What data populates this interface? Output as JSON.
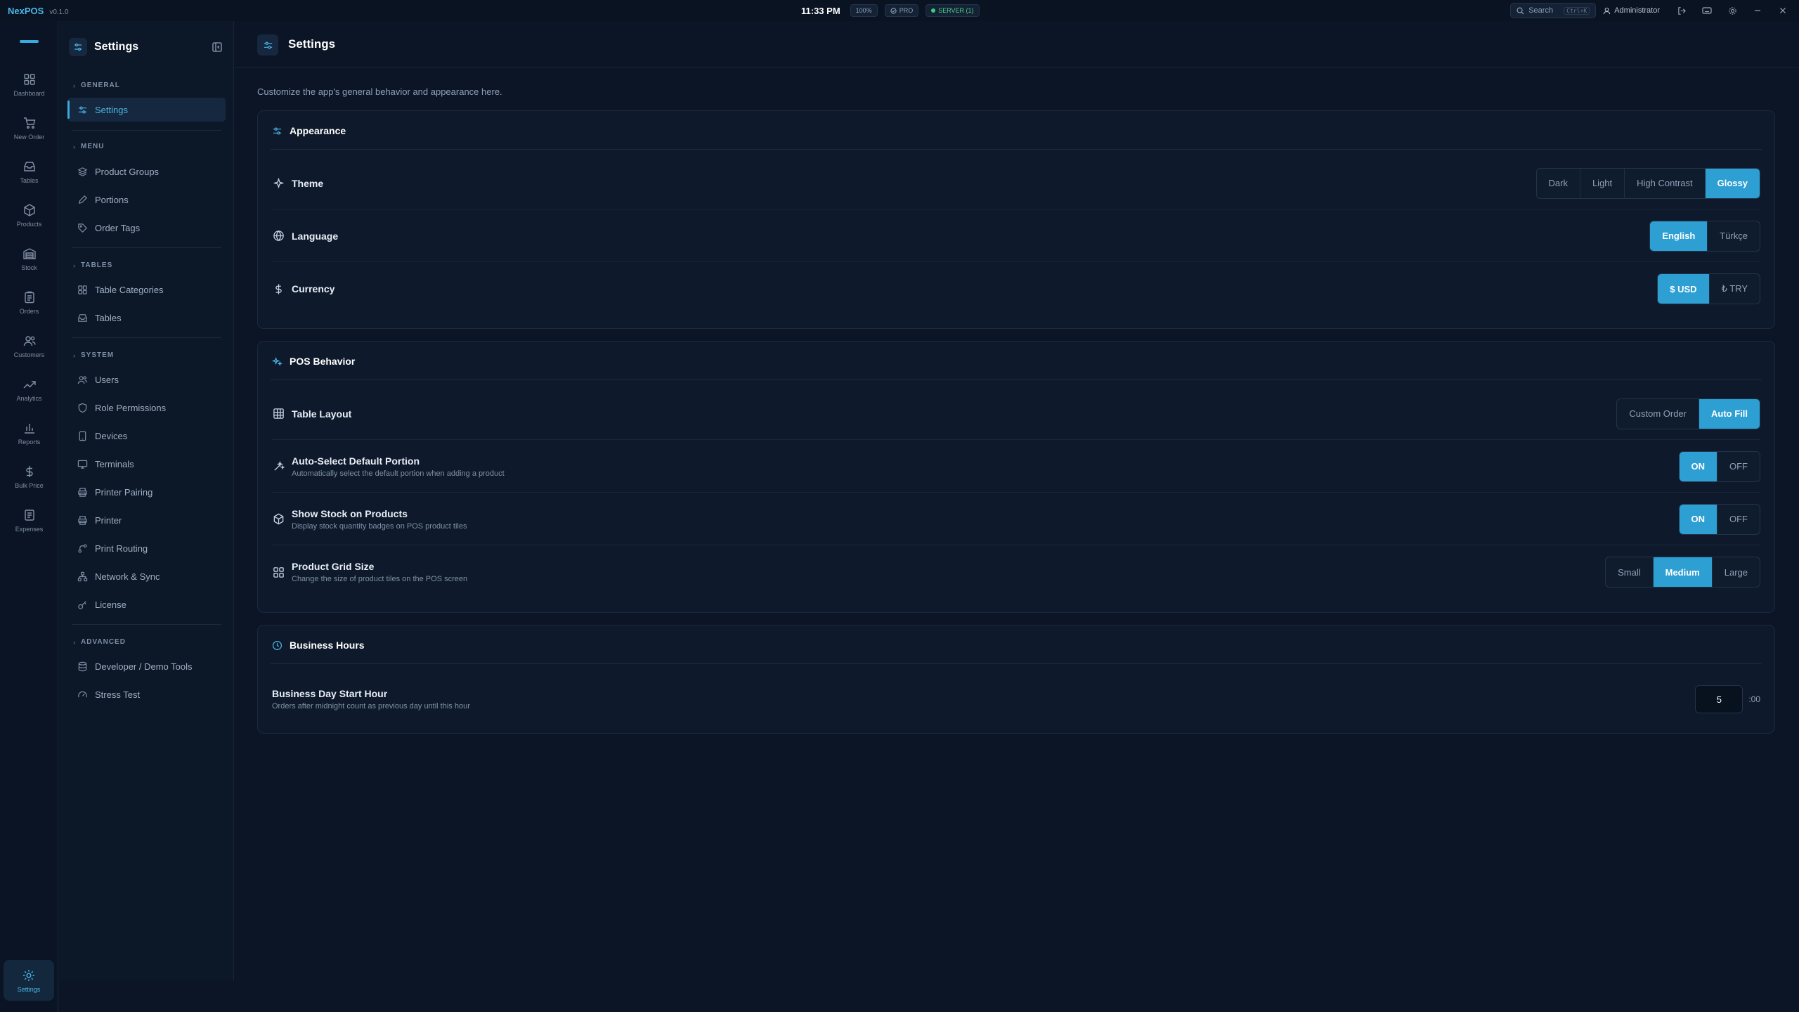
{
  "titlebar": {
    "app_name": "NexPOS",
    "version": "v0.1.0",
    "time": "11:33 PM",
    "zoom": "100%",
    "pro_badge": "PRO",
    "server_badge": "SERVER (1)",
    "search_label": "Search",
    "search_shortcut": "Ctrl+K",
    "user": "Administrator"
  },
  "rail": {
    "items": [
      {
        "label": "Dashboard",
        "icon": "dashboard-icon"
      },
      {
        "label": "New Order",
        "icon": "cart-icon"
      },
      {
        "label": "Tables",
        "icon": "inbox-icon"
      },
      {
        "label": "Products",
        "icon": "box-icon"
      },
      {
        "label": "Stock",
        "icon": "warehouse-icon"
      },
      {
        "label": "Orders",
        "icon": "clipboard-icon"
      },
      {
        "label": "Customers",
        "icon": "users-icon"
      },
      {
        "label": "Analytics",
        "icon": "trend-icon"
      },
      {
        "label": "Reports",
        "icon": "bar-chart-icon"
      },
      {
        "label": "Bulk Price",
        "icon": "dollar-icon"
      },
      {
        "label": "Expenses",
        "icon": "receipt-icon"
      }
    ],
    "settings_label": "Settings"
  },
  "sidebar": {
    "title": "Settings",
    "sections": {
      "general": "GENERAL",
      "menu": "MENU",
      "tables": "TABLES",
      "system": "SYSTEM",
      "advanced": "ADVANCED"
    },
    "items": {
      "settings": "Settings",
      "product_groups": "Product Groups",
      "portions": "Portions",
      "order_tags": "Order Tags",
      "table_categories": "Table Categories",
      "tables": "Tables",
      "users": "Users",
      "role_permissions": "Role Permissions",
      "devices": "Devices",
      "terminals": "Terminals",
      "printer_pairing": "Printer Pairing",
      "printer": "Printer",
      "print_routing": "Print Routing",
      "network_sync": "Network & Sync",
      "license": "License",
      "developer_tools": "Developer / Demo Tools",
      "stress_test": "Stress Test"
    }
  },
  "main": {
    "title": "Settings",
    "subtitle": "Customize the app's general behavior and appearance here.",
    "appearance": {
      "title": "Appearance",
      "theme": {
        "label": "Theme",
        "options": [
          "Dark",
          "Light",
          "High Contrast",
          "Glossy"
        ],
        "selected": "Glossy"
      },
      "language": {
        "label": "Language",
        "options": [
          "English",
          "Türkçe"
        ],
        "selected": "English"
      },
      "currency": {
        "label": "Currency",
        "options": [
          "$ USD",
          "₺ TRY"
        ],
        "selected": "$ USD"
      }
    },
    "pos": {
      "title": "POS Behavior",
      "table_layout": {
        "label": "Table Layout",
        "options": [
          "Custom Order",
          "Auto Fill"
        ],
        "selected": "Auto Fill"
      },
      "auto_select": {
        "label": "Auto-Select Default Portion",
        "desc": "Automatically select the default portion when adding a product",
        "on": "ON",
        "off": "OFF",
        "value": "ON"
      },
      "show_stock": {
        "label": "Show Stock on Products",
        "desc": "Display stock quantity badges on POS product tiles",
        "on": "ON",
        "off": "OFF",
        "value": "ON"
      },
      "grid_size": {
        "label": "Product Grid Size",
        "desc": "Change the size of product tiles on the POS screen",
        "options": [
          "Small",
          "Medium",
          "Large"
        ],
        "selected": "Medium"
      }
    },
    "hours": {
      "title": "Business Hours",
      "start": {
        "label": "Business Day Start Hour",
        "desc": "Orders after midnight count as previous day until this hour",
        "value": "5",
        "suffix": ":00"
      }
    }
  },
  "colors": {
    "accent": "#2e9fd3",
    "background": "#0b1525",
    "card": "#0e1a2b",
    "success": "#35d07f"
  }
}
